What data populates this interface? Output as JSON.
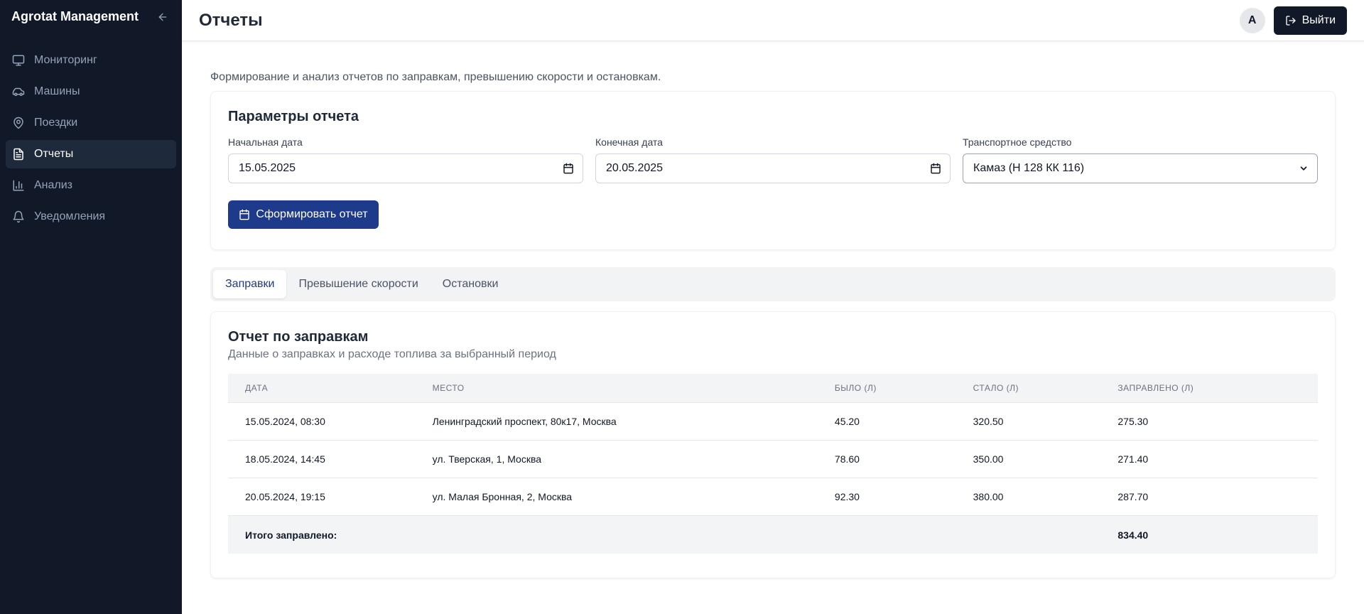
{
  "sidebar": {
    "brand": "Agrotat Management",
    "items": [
      {
        "label": "Мониторинг",
        "icon": "monitor-icon"
      },
      {
        "label": "Машины",
        "icon": "car-icon"
      },
      {
        "label": "Поездки",
        "icon": "map-pin-icon"
      },
      {
        "label": "Отчеты",
        "icon": "file-text-icon",
        "active": true
      },
      {
        "label": "Анализ",
        "icon": "bar-chart-icon"
      },
      {
        "label": "Уведомления",
        "icon": "bell-icon"
      }
    ]
  },
  "header": {
    "title": "Отчеты",
    "avatar_letter": "A",
    "logout_label": "Выйти"
  },
  "intro": "Формирование и анализ отчетов по заправкам, превышению скорости и остановкам.",
  "params": {
    "title": "Параметры отчета",
    "start_label": "Начальная дата",
    "start_value": "15.05.2025",
    "end_label": "Конечная дата",
    "end_value": "20.05.2025",
    "vehicle_label": "Транспортное средство",
    "vehicle_value": "Камаз (Н 128 КК 116)",
    "generate_label": "Сформировать отчет"
  },
  "tabs": [
    {
      "label": "Заправки",
      "active": true
    },
    {
      "label": "Превышение скорости"
    },
    {
      "label": "Остановки"
    }
  ],
  "report": {
    "title": "Отчет по заправкам",
    "subtitle": "Данные о заправках и расходе топлива за выбранный период",
    "columns": [
      "Дата",
      "Место",
      "Было (л)",
      "Стало (л)",
      "Заправлено (л)"
    ],
    "rows": [
      [
        "15.05.2024, 08:30",
        "Ленинградский проспект, 80к17, Москва",
        "45.20",
        "320.50",
        "275.30"
      ],
      [
        "18.05.2024, 14:45",
        "ул. Тверская, 1, Москва",
        "78.60",
        "350.00",
        "271.40"
      ],
      [
        "20.05.2024, 19:15",
        "ул. Малая Бронная, 2, Москва",
        "92.30",
        "380.00",
        "287.70"
      ]
    ],
    "total_label": "Итого заправлено:",
    "total_value": "834.40"
  },
  "colors": {
    "sidebar_bg": "#111827",
    "accent": "#1e3a8a",
    "logout_bg": "#111827"
  }
}
